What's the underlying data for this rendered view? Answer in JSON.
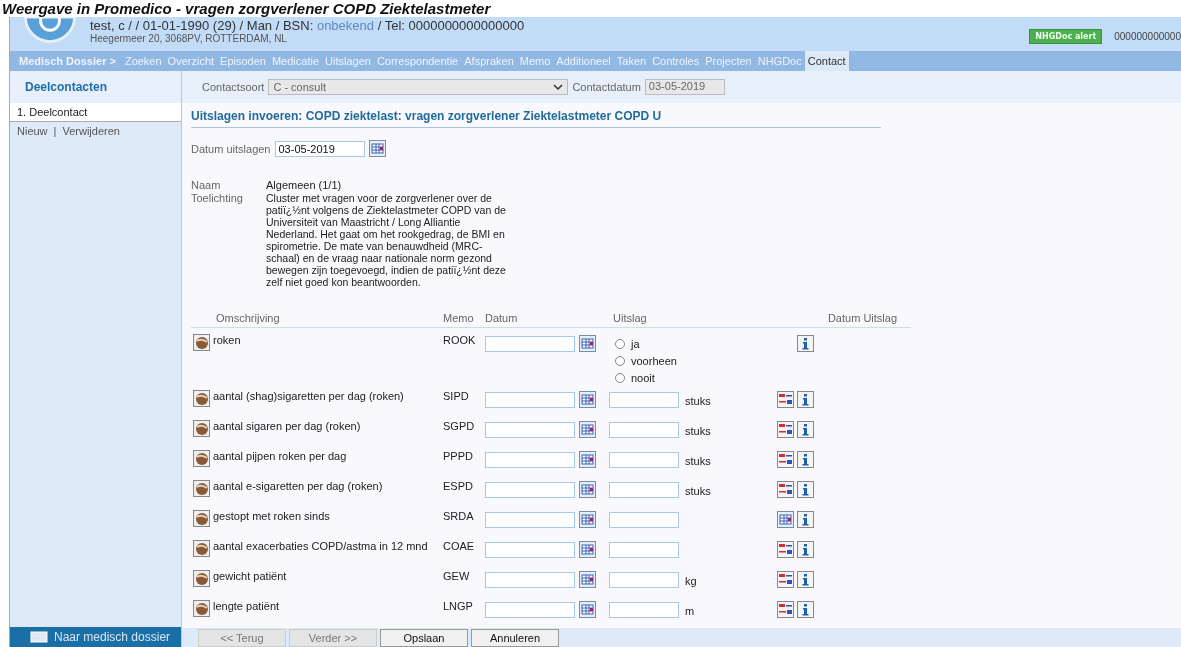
{
  "page_title": "Weergave in Promedico - vragen zorgverlener COPD Ziektelastmeter",
  "patient": {
    "line": "test, c / / 01-01-1990 (29) / Man / BSN:",
    "bsn": "onbekend",
    "tel": "/ Tel: 0000000000000000",
    "address": "Heegermeer 20, 3068PV, ROTTERDAM, NL"
  },
  "alert": "NHGDoc alert",
  "header_number": "000000000000",
  "nav": [
    {
      "label": "Medisch Dossier >",
      "selected": false,
      "kind": "root"
    },
    {
      "label": "Zoeken",
      "selected": false,
      "kind": "item"
    },
    {
      "label": "Overzicht",
      "selected": false,
      "kind": "item"
    },
    {
      "label": "Episoden",
      "selected": false,
      "kind": "item"
    },
    {
      "label": "Medicatie",
      "selected": false,
      "kind": "item"
    },
    {
      "label": "Uitslagen",
      "selected": false,
      "kind": "item"
    },
    {
      "label": "Correspondentie",
      "selected": false,
      "kind": "item"
    },
    {
      "label": "Afspraken",
      "selected": false,
      "kind": "item"
    },
    {
      "label": "Memo",
      "selected": false,
      "kind": "item"
    },
    {
      "label": "Additioneel",
      "selected": false,
      "kind": "item"
    },
    {
      "label": "Taken",
      "selected": false,
      "kind": "item"
    },
    {
      "label": "Controles",
      "selected": false,
      "kind": "item"
    },
    {
      "label": "Projecten",
      "selected": false,
      "kind": "item"
    },
    {
      "label": "NHGDoc",
      "selected": false,
      "kind": "item"
    },
    {
      "label": "Contact",
      "selected": true,
      "kind": "item"
    }
  ],
  "sidebar": {
    "title": "Deelcontacten",
    "items": [
      {
        "label": "1. Deelcontact",
        "selected": true
      }
    ],
    "links": [
      "Nieuw",
      "Verwijderen"
    ],
    "separator": "|",
    "footer_button": "Naar medisch dossier"
  },
  "contact_bar": {
    "type_label": "Contactsoort",
    "type_value": "C - consult",
    "date_label": "Contactdatum",
    "date_value": "03-05-2019"
  },
  "form": {
    "heading": "Uitslagen invoeren: COPD ziektelast: vragen zorgverlener Ziektelastmeter COPD U",
    "date_label": "Datum uitslagen",
    "date_value": "03-05-2019",
    "name_label": "Naam",
    "name_value": "Algemeen (1/1)",
    "note_label": "Toelichting",
    "note_value": "Cluster met vragen voor de zorgverlener over de patiï¿½nt volgens de Ziektelastmeter COPD van de Universiteit van Maastricht / Long Alliantie Nederland. Het gaat om het rookgedrag, de BMI en spirometrie. De mate van benauwdheid (MRC-schaal) en de vraag naar nationale norm gezond bewegen zijn toegevoegd, indien de patiï¿½nt deze zelf niet goed kon beantwoorden.",
    "columns": [
      "Omschrijving",
      "Memo",
      "Datum",
      "Uitslag",
      "Datum Uitslag"
    ],
    "rows": [
      {
        "label": "roken",
        "memo": "ROOK",
        "kind": "radio",
        "options": [
          {
            "label": "ja",
            "selected": false
          },
          {
            "label": "voorheen",
            "selected": false
          },
          {
            "label": "nooit",
            "selected": false
          }
        ]
      },
      {
        "label": "aantal (shag)sigaretten per dag (roken)",
        "memo": "SIPD",
        "kind": "input",
        "unit": "stuks",
        "tool": {
          "kind": "chart"
        }
      },
      {
        "label": "aantal sigaren per dag (roken)",
        "memo": "SGPD",
        "kind": "input",
        "unit": "stuks",
        "tool": {
          "kind": "chart"
        }
      },
      {
        "label": "aantal pijpen roken per dag",
        "memo": "PPPD",
        "kind": "input",
        "unit": "stuks",
        "tool": {
          "kind": "chart"
        }
      },
      {
        "label": "aantal e-sigaretten per dag (roken)",
        "memo": "ESPD",
        "kind": "input",
        "unit": "stuks",
        "tool": {
          "kind": "chart"
        }
      },
      {
        "label": "gestopt met roken sinds",
        "memo": "SRDA",
        "kind": "input",
        "tool": {
          "kind": "calendar"
        }
      },
      {
        "label": "aantal exacerbaties COPD/astma in 12 mnd",
        "memo": "COAE",
        "kind": "input",
        "tool": {
          "kind": "chart"
        }
      },
      {
        "label": "gewicht patiënt",
        "memo": "GEW",
        "kind": "input",
        "unit": "kg",
        "tool": {
          "kind": "chart"
        }
      },
      {
        "label": "lengte patiënt",
        "memo": "LNGP",
        "kind": "input",
        "unit": "m",
        "tool": {
          "kind": "chart"
        }
      }
    ]
  },
  "buttons": [
    {
      "label": "<< Terug",
      "disabled": true
    },
    {
      "label": "Verder >>",
      "disabled": true
    },
    {
      "label": "Opslaan",
      "disabled": false
    },
    {
      "label": "Annuleren",
      "disabled": false
    }
  ]
}
